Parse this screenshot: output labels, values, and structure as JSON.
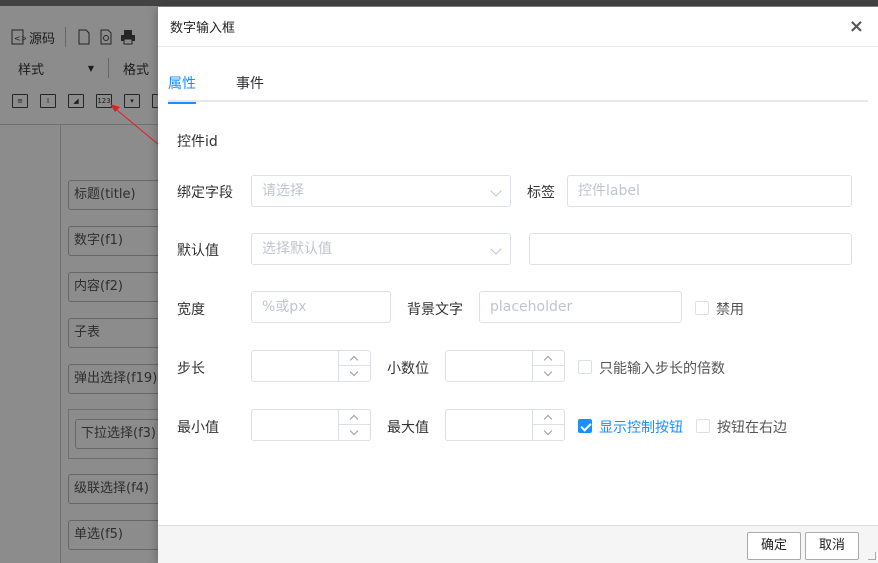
{
  "editor": {
    "toolbar": {
      "source_label": "源码",
      "style_label": "样式",
      "format_label": "格式"
    },
    "mini_icons": [
      "text-icon",
      "field-icon",
      "image-field-icon",
      "number-icon",
      "dropdown-icon",
      "more-icon"
    ],
    "number_icon_text": "123",
    "fields": [
      {
        "label": "标题(title)"
      },
      {
        "label": "数字(f1)"
      },
      {
        "label": "内容(f2)"
      },
      {
        "label": "子表"
      },
      {
        "label": "弹出选择(f19)"
      },
      {
        "label": "下拉选择(f3)"
      },
      {
        "label": "级联选择(f4)"
      },
      {
        "label": "单选(f5)"
      }
    ]
  },
  "dialog": {
    "title": "数字输入框",
    "close_icon": "×",
    "tabs": [
      {
        "label": "属性",
        "active": true
      },
      {
        "label": "事件",
        "active": false
      }
    ],
    "form": {
      "control_id_label": "控件id",
      "bind_field_label": "绑定字段",
      "bind_field_placeholder": "请选择",
      "tag_label": "标签",
      "tag_placeholder": "控件label",
      "default_label": "默认值",
      "default_placeholder": "选择默认值",
      "width_label": "宽度",
      "width_placeholder": "%或px",
      "bg_text_label": "背景文字",
      "bg_text_placeholder": "placeholder",
      "disabled_label": "禁用",
      "step_label": "步长",
      "decimals_label": "小数位",
      "step_multiple_label": "只能输入步长的倍数",
      "min_label": "最小值",
      "max_label": "最大值",
      "show_controls_label": "显示控制按钮",
      "controls_right_label": "按钮在右边"
    },
    "checks": {
      "disabled": false,
      "step_multiple": false,
      "show_controls": true,
      "controls_right": false
    },
    "footer": {
      "ok_label": "确定",
      "cancel_label": "取消"
    },
    "accent_color": "#1890ff"
  }
}
